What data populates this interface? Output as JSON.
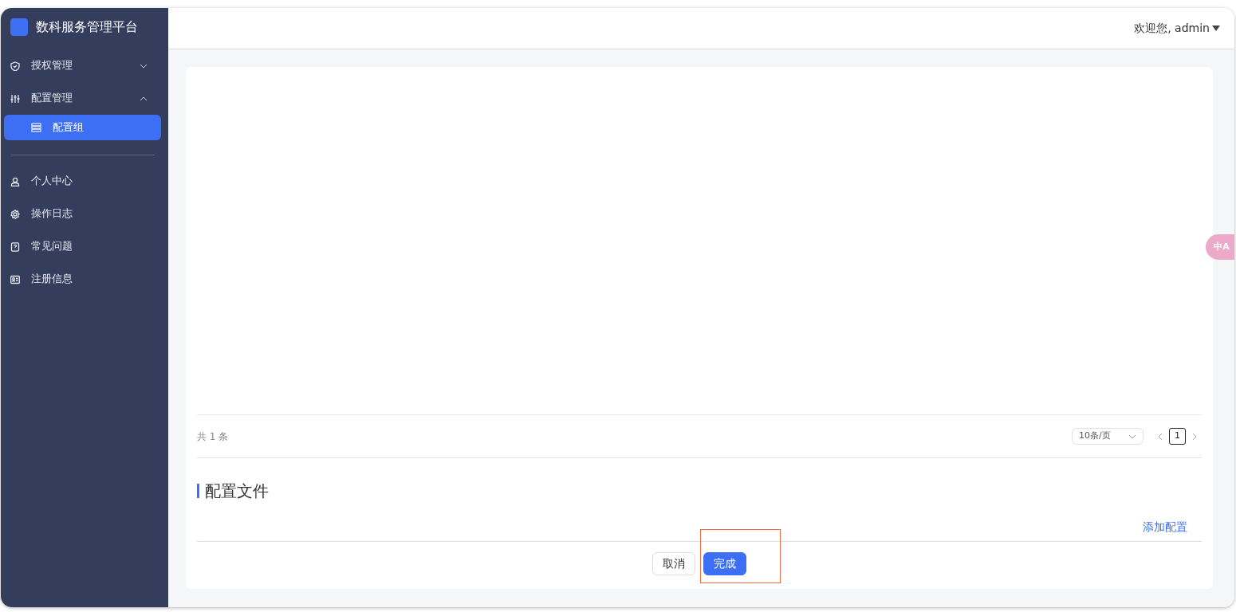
{
  "sidebar": {
    "title": "数科服务管理平台",
    "items": [
      {
        "label": "授权管理",
        "expanded": false
      },
      {
        "label": "配置管理",
        "expanded": true,
        "children": [
          {
            "label": "配置组",
            "selected": true
          }
        ]
      }
    ],
    "bottom_items": [
      {
        "label": "个人中心"
      },
      {
        "label": "操作日志"
      },
      {
        "label": "常见问题"
      },
      {
        "label": "注册信息"
      }
    ]
  },
  "header": {
    "user_menu": "欢迎您, admin"
  },
  "pagination": {
    "total": "共 1 条",
    "page_size": "10条/页",
    "pages": [
      {
        "label": "1",
        "selected": true
      }
    ]
  },
  "section": {
    "title": "配置文件",
    "add_link": "添加配置"
  },
  "buttons": [
    {
      "label": "取消",
      "kind": "secondary"
    },
    {
      "label": "完成",
      "kind": "primary"
    }
  ],
  "translate_button": "中A"
}
